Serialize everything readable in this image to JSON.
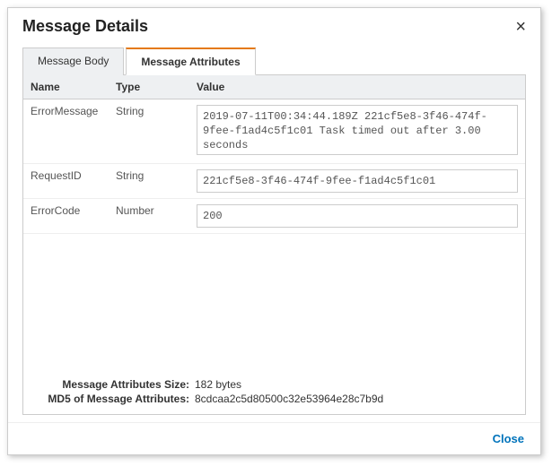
{
  "header": {
    "title": "Message Details"
  },
  "tabs": {
    "body_label": "Message Body",
    "attrs_label": "Message Attributes"
  },
  "columns": {
    "name": "Name",
    "type": "Type",
    "value": "Value"
  },
  "rows": [
    {
      "name": "ErrorMessage",
      "type": "String",
      "value": "2019-07-11T00:34:44.189Z 221cf5e8-3f46-474f-9fee-f1ad4c5f1c01 Task timed out after 3.00 seconds"
    },
    {
      "name": "RequestID",
      "type": "String",
      "value": "221cf5e8-3f46-474f-9fee-f1ad4c5f1c01"
    },
    {
      "name": "ErrorCode",
      "type": "Number",
      "value": "200"
    }
  ],
  "meta": {
    "size_label": "Message Attributes Size:",
    "size_value": "182 bytes",
    "md5_label": "MD5 of Message Attributes:",
    "md5_value": "8cdcaa2c5d80500c32e53964e28c7b9d"
  },
  "footer": {
    "close_label": "Close"
  }
}
